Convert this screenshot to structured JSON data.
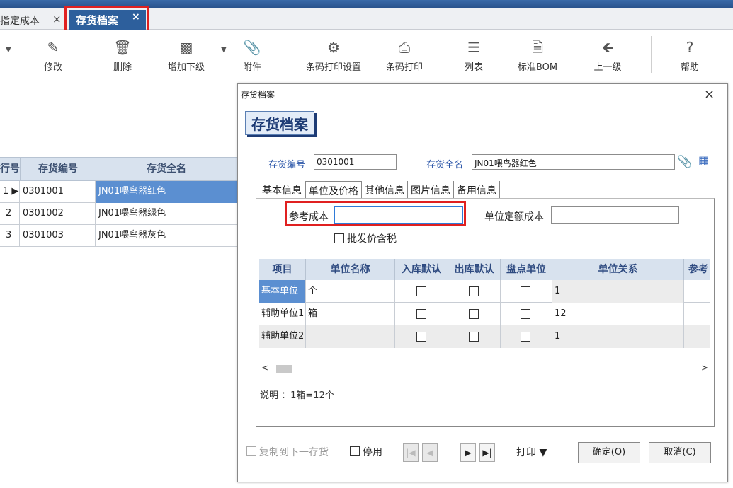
{
  "window": {},
  "tabs": {
    "prev_tab_label": "指定成本",
    "close_glyph": "×",
    "active_tab_label": "存货档案",
    "active_close_glyph": "×"
  },
  "toolbar": {
    "items": [
      {
        "label": "修改",
        "icon": "edit-icon"
      },
      {
        "label": "删除",
        "icon": "trash-icon"
      },
      {
        "label": "增加下级",
        "icon": "hierarchy-icon"
      },
      {
        "label": "附件",
        "icon": "paperclip-icon"
      },
      {
        "label": "条码打印设置",
        "icon": "gear-icon"
      },
      {
        "label": "条码打印",
        "icon": "printer-icon"
      },
      {
        "label": "列表",
        "icon": "list-icon"
      },
      {
        "label": "标准BOM",
        "icon": "document-search-icon"
      },
      {
        "label": "上一级",
        "icon": "arrow-left-icon"
      },
      {
        "label": "帮助",
        "icon": "question-icon"
      }
    ]
  },
  "list": {
    "columns": [
      "行号",
      "存货编号",
      "存货全名"
    ],
    "rows": [
      {
        "no": "1",
        "code": "0301001",
        "name": "JN01喂鸟器红色"
      },
      {
        "no": "2",
        "code": "0301002",
        "name": "JN01喂鸟器绿色"
      },
      {
        "no": "3",
        "code": "0301003",
        "name": "JN01喂鸟器灰色"
      }
    ]
  },
  "dialog": {
    "window_title": "存货档案",
    "heading": "存货档案",
    "code_label": "存货编号",
    "code_value": "0301001",
    "name_label": "存货全名",
    "name_value": "JN01喂鸟器红色",
    "close_glyph": "×",
    "subtabs": [
      "基本信息",
      "单位及价格",
      "其他信息",
      "图片信息",
      "备用信息"
    ],
    "ref_cost_label": "参考成本",
    "ref_cost_value": "",
    "unit_quota_cost_label": "单位定额成本",
    "unit_quota_cost_value": "",
    "wholesale_tax_label": "批发价含税",
    "unit_table": {
      "columns": [
        "项目",
        "单位名称",
        "入库默认",
        "出库默认",
        "盘点单位",
        "单位关系",
        "参考"
      ],
      "rows": [
        {
          "item": "基本单位",
          "unit": "个",
          "relation": "1"
        },
        {
          "item": "辅助单位1",
          "unit": "箱",
          "relation": "12"
        },
        {
          "item": "辅助单位2",
          "unit": "",
          "relation": "1"
        }
      ]
    },
    "note": "说明 ：1箱=12个",
    "copy_next_label": "复制到下一存货",
    "disable_label": "停用",
    "print_label": "打印 ▼",
    "ok_label": "确定(O)",
    "cancel_label": "取消(C)"
  }
}
